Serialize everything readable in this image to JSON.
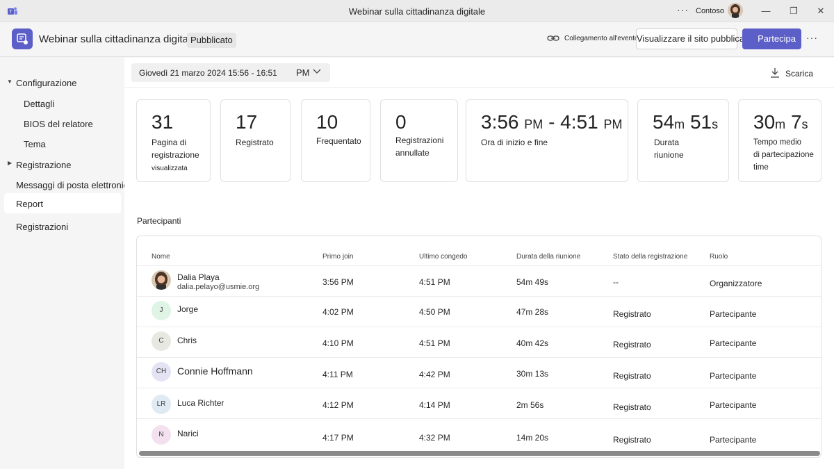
{
  "window": {
    "title": "Webinar sulla cittadinanza digitale",
    "more_glyph": "···",
    "tenant": "Contoso",
    "minimize_glyph": "—",
    "restore_glyph": "❐",
    "close_glyph": "✕"
  },
  "header": {
    "event_title": "Webinar sulla cittadinanza digitale",
    "status": "Pubblicato",
    "event_link_label": "Collegamento all'evento Copy",
    "view_site_button": "Visualizzare il sito pubblicato",
    "join_button": "Partecipa",
    "more_glyph": "···"
  },
  "sidebar": {
    "configuration": "Configurazione",
    "details": "Dettagli",
    "presenter_bios": "BIOS del relatore",
    "theme": "Tema",
    "registration": "Registrazione",
    "emails": "Messaggi di posta elettronica",
    "report": "Report",
    "recordings": "Registrazioni"
  },
  "toolbar": {
    "date_range": "Giovedì 21 marzo 2024 15:56 - 16:51",
    "date_suffix": "PM",
    "download_label": "Scarica"
  },
  "stats": [
    {
      "value": "31",
      "label_lines": [
        "Pagina di",
        "registrazione"
      ],
      "sublabel": "visualizzata"
    },
    {
      "value": "17",
      "label_lines": [
        "Registrato"
      ]
    },
    {
      "value": "10",
      "label_lines": [
        "Frequentato"
      ]
    },
    {
      "value": "0",
      "label_lines": [
        "Registrazioni",
        "annullate"
      ]
    },
    {
      "value_a": "3:56",
      "unit_a": "PM",
      "sep": "-",
      "value_b": "4:51",
      "unit_b": "PM",
      "label_lines": [
        "Ora di inizio e fine"
      ]
    },
    {
      "value_a": "54",
      "unit_a": "m",
      "value_b": "51",
      "unit_b": "s",
      "label_lines": [
        "Durata",
        "riunione"
      ]
    },
    {
      "value_a": "30",
      "unit_a": "m",
      "value_b": "7",
      "unit_b": "s",
      "label_lines": [
        "Tempo medio",
        "di partecipazione",
        "time"
      ]
    }
  ],
  "participants": {
    "title": "Partecipanti",
    "columns": [
      "Nome",
      "Primo join",
      "Ultimo congedo",
      "Durata della riunione",
      "Stato della registrazione",
      "Ruolo"
    ],
    "rows": [
      {
        "initials": "",
        "name": "Dalia Playa",
        "email": "dalia.pelayo@usmie.org",
        "first_join": "3:56 PM",
        "last_leave": "4:51 PM",
        "duration": "54m 49s",
        "status": "--",
        "role": "Organizzatore"
      },
      {
        "initials": "J",
        "name": "Jorge",
        "first_join": "4:02 PM",
        "last_leave": "4:50 PM",
        "duration": "47m 28s",
        "status": "Registrato",
        "role": "Partecipante"
      },
      {
        "initials": "C",
        "name": "Chris",
        "first_join": "4:10 PM",
        "last_leave": "4:51 PM",
        "duration": "40m 42s",
        "status": "Registrato",
        "role": "Partecipante"
      },
      {
        "initials": "CH",
        "name": "Connie Hoffmann",
        "first_join": "4:11 PM",
        "last_leave": "4:42 PM",
        "duration": "30m 13s",
        "status": "Registrato",
        "role": "Partecipante"
      },
      {
        "initials": "LR",
        "name": "Luca Richter",
        "first_join": "4:12 PM",
        "last_leave": "4:14 PM",
        "duration": "2m 56s",
        "status": "Registrato",
        "role": "Partecipante"
      },
      {
        "initials": "N",
        "name": "Narici",
        "first_join": "4:17 PM",
        "last_leave": "4:32 PM",
        "duration": "14m 20s",
        "status": "Registrato",
        "role": "Partecipante"
      }
    ]
  },
  "colors": {
    "accent": "#5b5fc7",
    "avatar_j": "#dff4e5",
    "avatar_c": "#e8e8e2",
    "avatar_ch": "#e3e3f4",
    "avatar_lr": "#dfeaf2",
    "avatar_n": "#f3e1ef"
  }
}
